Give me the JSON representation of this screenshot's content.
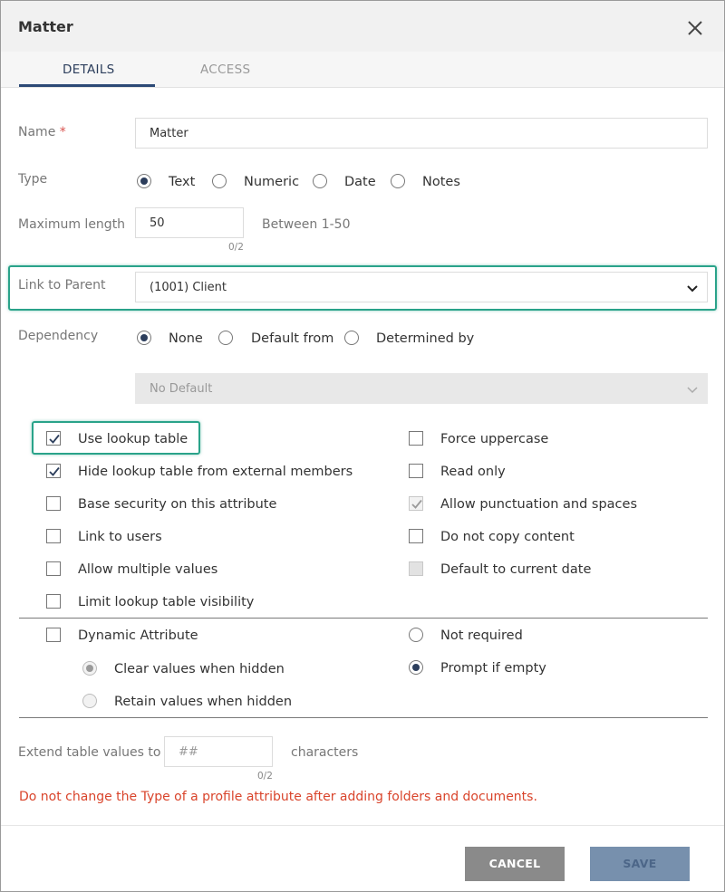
{
  "dialog": {
    "title": "Matter"
  },
  "tabs": [
    {
      "label": "DETAILS"
    },
    {
      "label": "ACCESS"
    }
  ],
  "fields": {
    "name": {
      "label": "Name",
      "required_mark": "*",
      "value": "Matter"
    },
    "type": {
      "label": "Type",
      "options": [
        "Text",
        "Numeric",
        "Date",
        "Notes"
      ],
      "selected": "Text"
    },
    "max_length": {
      "label": "Maximum length",
      "value": "50",
      "counter": "0/2",
      "hint": "Between 1-50"
    },
    "link_to_parent": {
      "label": "Link to Parent",
      "value": "(1001) Client"
    },
    "dependency": {
      "label": "Dependency",
      "options": [
        "None",
        "Default from",
        "Determined by"
      ],
      "selected": "None",
      "default_select": "No Default"
    }
  },
  "checkboxes_left": [
    {
      "label": "Use lookup table",
      "checked": true
    },
    {
      "label": "Hide lookup table from external members",
      "checked": true
    },
    {
      "label": "Base security on this attribute",
      "checked": false
    },
    {
      "label": "Link to users",
      "checked": false
    },
    {
      "label": "Allow multiple values",
      "checked": false
    },
    {
      "label": "Limit lookup table visibility",
      "checked": false
    }
  ],
  "checkboxes_right": [
    {
      "label": "Force uppercase",
      "checked": false
    },
    {
      "label": "Read only",
      "checked": false
    },
    {
      "label": "Allow punctuation and spaces",
      "checked": true,
      "disabled": true
    },
    {
      "label": "Do not copy content",
      "checked": false
    },
    {
      "label": "Default to current date",
      "checked": false,
      "disabled": true
    }
  ],
  "dynamic": {
    "label": "Dynamic Attribute",
    "checked": false,
    "hidden_options": [
      "Clear values when hidden",
      "Retain values when hidden"
    ],
    "hidden_selected": "Clear values when hidden"
  },
  "required_options": [
    "Not required",
    "Prompt if empty"
  ],
  "required_selected": "Prompt if empty",
  "extend": {
    "label": "Extend table values to",
    "placeholder": "##",
    "counter": "0/2",
    "suffix": "characters"
  },
  "warning": "Do not change the Type of a profile attribute after adding folders and documents.",
  "buttons": {
    "cancel": "CANCEL",
    "save": "SAVE"
  },
  "colors": {
    "accent": "#2c4a76",
    "highlight": "#2aa38a",
    "warning": "#d9442b"
  }
}
